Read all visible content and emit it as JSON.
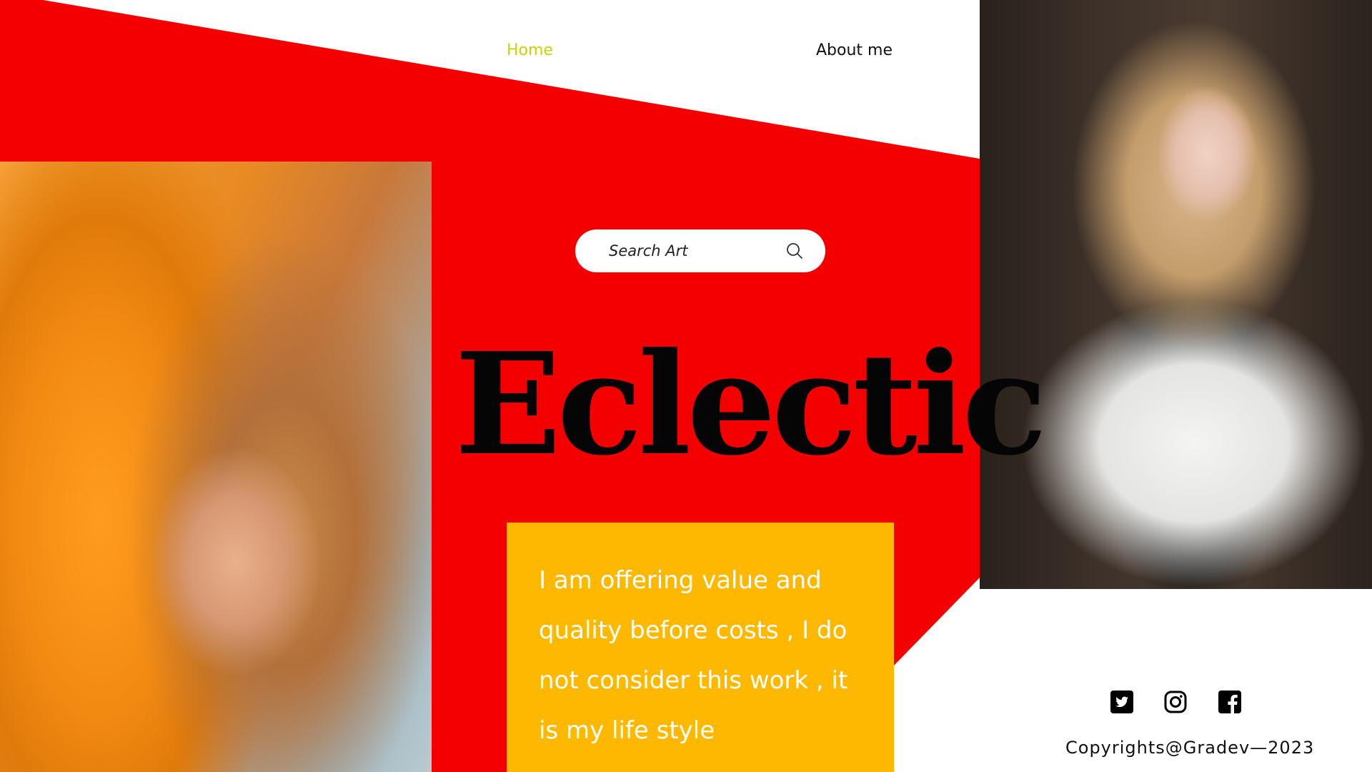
{
  "colors": {
    "primary_red": "#f50000",
    "accent_yellow": "#ffb800",
    "nav_active": "#c6d400",
    "text_dark": "#111111"
  },
  "nav": {
    "items": [
      {
        "label": "Home",
        "active": true
      },
      {
        "label": "About me",
        "active": false
      }
    ]
  },
  "search": {
    "placeholder": "Search Art",
    "icon": "search-icon"
  },
  "hero": {
    "title": "Eclectic"
  },
  "card": {
    "text": "I am offering value and quality before costs , I do not consider this work , it is my life style"
  },
  "social": {
    "icons": [
      "twitter-icon",
      "instagram-icon",
      "facebook-icon"
    ]
  },
  "footer": {
    "copyright": "Copyrights@Gradev—2023"
  }
}
